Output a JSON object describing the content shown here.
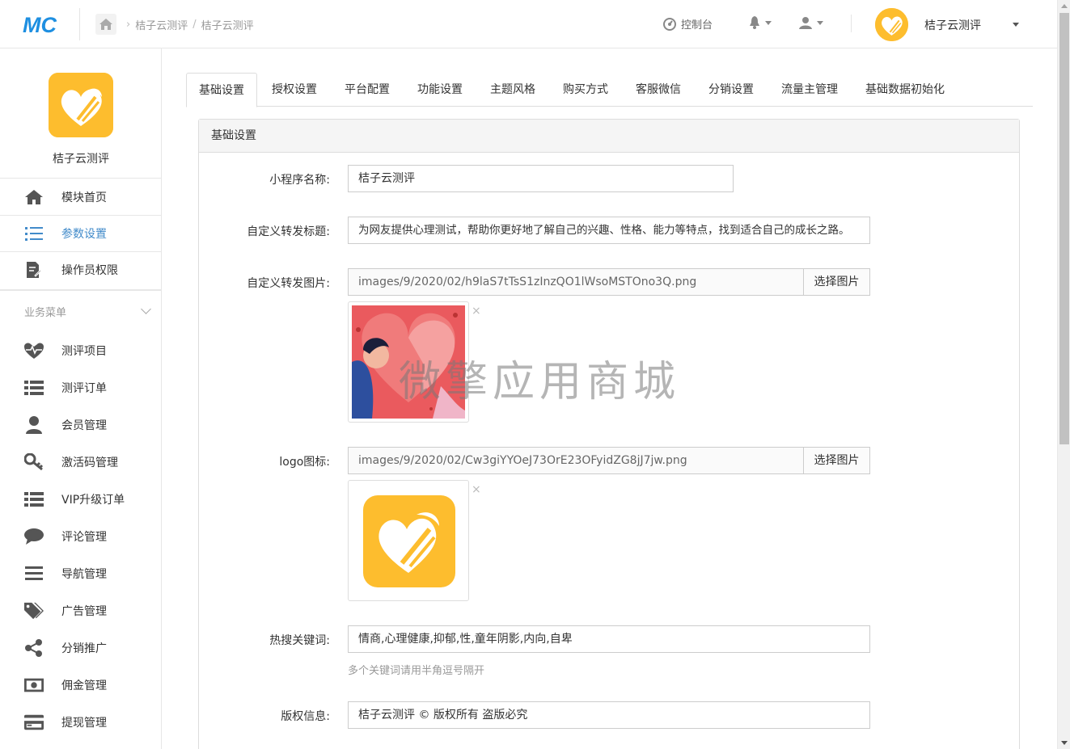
{
  "header": {
    "logo_text": "MC",
    "breadcrumb": [
      "桔子云测评",
      "桔子云测评"
    ],
    "breadcrumb_sep": "/",
    "console_label": "控制台",
    "account_name": "桔子云测评"
  },
  "sidebar": {
    "app_name": "桔子云测评",
    "top_items": [
      {
        "label": "模块首页",
        "icon": "home-icon"
      },
      {
        "label": "参数设置",
        "icon": "list-icon",
        "active": true
      },
      {
        "label": "操作员权限",
        "icon": "edit-doc-icon"
      }
    ],
    "section_title": "业务菜单",
    "business_items": [
      {
        "label": "测评项目",
        "icon": "heartbeat-icon"
      },
      {
        "label": "测评订单",
        "icon": "list-bullets-icon"
      },
      {
        "label": "会员管理",
        "icon": "user-icon"
      },
      {
        "label": "激活码管理",
        "icon": "key-icon"
      },
      {
        "label": "VIP升级订单",
        "icon": "list-bullets-icon"
      },
      {
        "label": "评论管理",
        "icon": "comment-icon"
      },
      {
        "label": "导航管理",
        "icon": "menu-icon"
      },
      {
        "label": "广告管理",
        "icon": "tags-icon"
      },
      {
        "label": "分销推广",
        "icon": "share-icon"
      },
      {
        "label": "佣金管理",
        "icon": "money-icon"
      },
      {
        "label": "提现管理",
        "icon": "credit-card-icon"
      }
    ]
  },
  "tabs": [
    "基础设置",
    "授权设置",
    "平台配置",
    "功能设置",
    "主题风格",
    "购买方式",
    "客服微信",
    "分销设置",
    "流量主管理",
    "基础数据初始化"
  ],
  "panel": {
    "heading": "基础设置",
    "app_name_label": "小程序名称:",
    "app_name_value": "桔子云测评",
    "share_title_label": "自定义转发标题:",
    "share_title_value": "为网友提供心理测试，帮助你更好地了解自己的兴趣、性格、能力等特点，找到适合自己的成长之路。",
    "share_image_label": "自定义转发图片:",
    "share_image_value": "images/9/2020/02/h9laS7tTsS1zInzQO1lWsoMSTOno3Q.png",
    "select_image_label": "选择图片",
    "logo_label": "logo图标:",
    "logo_value": "images/9/2020/02/Cw3giYYOeJ73OrE23OFyidZG8jJ7jw.png",
    "hot_keywords_label": "热搜关键词:",
    "hot_keywords_value": "情商,心理健康,抑郁,性,童年阴影,内向,自卑",
    "hot_keywords_help": "多个关键词请用半角逗号隔开",
    "copyright_label": "版权信息:",
    "copyright_value": "桔子云测评 © 版权所有 盗版必究",
    "remove_glyph": "×"
  },
  "watermark": "微擎应用商城",
  "colors": {
    "accent": "#428bca",
    "brand_yellow": "#fdbd2e",
    "logo_blue": "#1e8fe1"
  }
}
